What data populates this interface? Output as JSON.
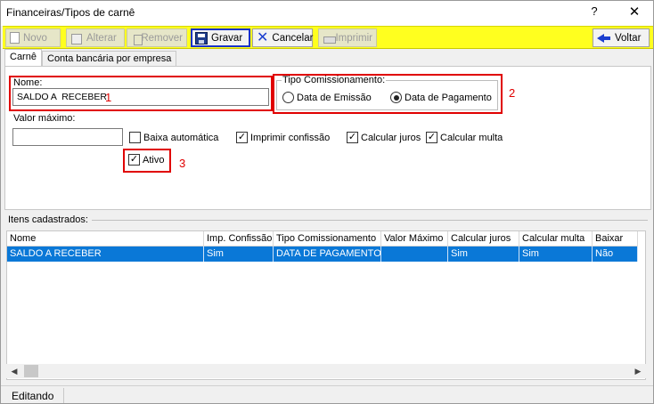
{
  "window": {
    "title": "Financeiras/Tipos de carnê",
    "help": "?",
    "close": "✕"
  },
  "toolbar": {
    "novo": "Novo",
    "alterar": "Alterar",
    "remover": "Remover",
    "gravar": "Gravar",
    "cancelar": "Cancelar",
    "imprimir": "Imprimir",
    "voltar": "Voltar",
    "bg_color": "#ffff1f"
  },
  "tabs": [
    "Carnê",
    "Conta bancária por empresa"
  ],
  "form": {
    "nome_label": "Nome:",
    "nome_value": "SALDO A  RECEBER",
    "tipo_label": "Tipo Comissionamento:",
    "radio_emissao": "Data de Emissão",
    "radio_pagamento": "Data de Pagamento",
    "radio_selected": "Data de Pagamento",
    "valor_label": "Valor máximo:",
    "valor_value": "",
    "checks": {
      "baixa": {
        "label": "Baixa automática",
        "checked": false
      },
      "imprimir": {
        "label": "Imprimir confissão",
        "checked": true
      },
      "juros": {
        "label": "Calcular juros",
        "checked": true
      },
      "multa": {
        "label": "Calcular multa",
        "checked": true
      },
      "ativo": {
        "label": "Ativo",
        "checked": true
      }
    }
  },
  "annotations": {
    "one": "1",
    "two": "2",
    "three": "3",
    "color": "#e00000"
  },
  "list": {
    "title": "Itens cadastrados:",
    "columns": [
      "Nome",
      "Imp. Confissão",
      "Tipo Comissionamento",
      "Valor Máximo",
      "Calcular juros",
      "Calcular multa",
      "Baixar"
    ],
    "rows": [
      [
        "SALDO A  RECEBER",
        "Sim",
        "DATA DE PAGAMENTO",
        "",
        "Sim",
        "Sim",
        "Não"
      ]
    ],
    "selected_color": "#0a78d7"
  },
  "status": {
    "text": "Editando"
  }
}
